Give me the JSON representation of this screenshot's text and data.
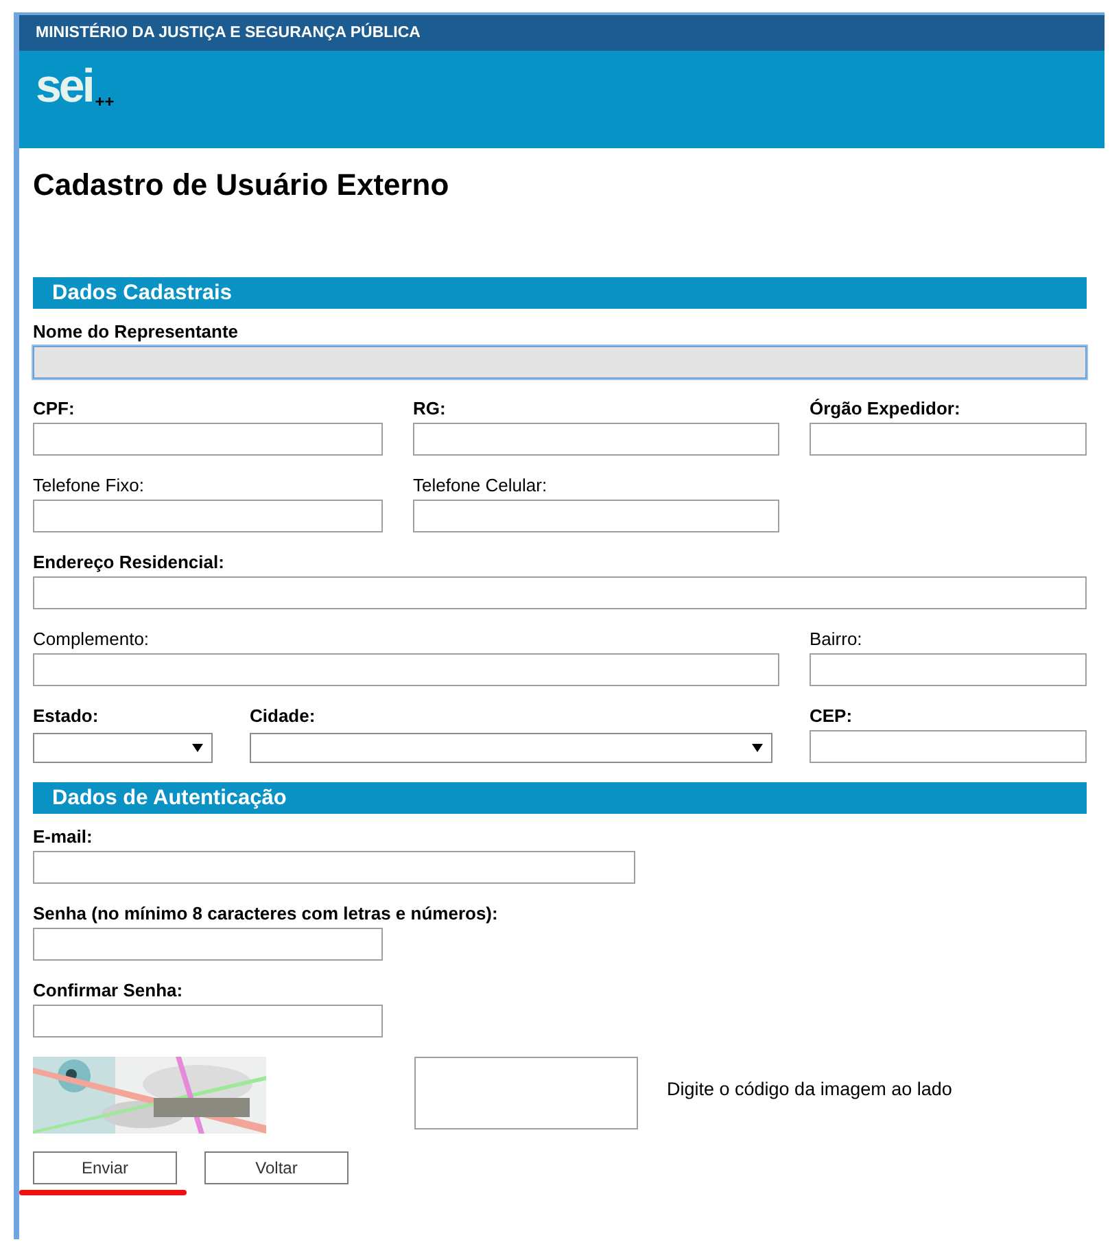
{
  "header": {
    "ministry": "MINISTÉRIO DA JUSTIÇA E SEGURANÇA PÚBLICA",
    "logo_text": "sei",
    "logo_suffix": "++"
  },
  "title": "Cadastro de Usuário Externo",
  "sections": [
    {
      "heading": "Dados Cadastrais",
      "fields": [
        {
          "label": "Nome do Representante",
          "required": true,
          "kind": "text",
          "focused": true
        },
        {
          "label": "CPF:",
          "required": true,
          "kind": "text",
          "focused": false
        },
        {
          "label": "RG:",
          "required": true,
          "kind": "text",
          "focused": false
        },
        {
          "label": "Órgão Expedidor:",
          "required": true,
          "kind": "text",
          "focused": false
        },
        {
          "label": "Telefone Fixo:",
          "required": false,
          "kind": "text",
          "focused": false
        },
        {
          "label": "Telefone Celular:",
          "required": false,
          "kind": "text",
          "focused": false
        },
        {
          "label": "Endereço Residencial:",
          "required": true,
          "kind": "text",
          "focused": false
        },
        {
          "label": "Complemento:",
          "required": false,
          "kind": "text",
          "focused": false
        },
        {
          "label": "Bairro:",
          "required": false,
          "kind": "text",
          "focused": false
        },
        {
          "label": "Estado:",
          "required": true,
          "kind": "select",
          "focused": false
        },
        {
          "label": "Cidade:",
          "required": true,
          "kind": "select",
          "focused": false
        },
        {
          "label": "CEP:",
          "required": true,
          "kind": "text",
          "focused": false
        }
      ]
    },
    {
      "heading": "Dados de Autenticação",
      "fields": [
        {
          "label": "E-mail:",
          "required": true,
          "kind": "text",
          "focused": false
        },
        {
          "label": "Senha (no mínimo 8 caracteres com letras e números):",
          "required": true,
          "kind": "password",
          "focused": false
        },
        {
          "label": "Confirmar Senha:",
          "required": true,
          "kind": "password",
          "focused": false
        }
      ]
    }
  ],
  "captcha": {
    "hint": "Digite o código da imagem ao lado"
  },
  "buttons": [
    {
      "label": "Enviar",
      "underlined": true
    },
    {
      "label": "Voltar",
      "underlined": false
    }
  ]
}
